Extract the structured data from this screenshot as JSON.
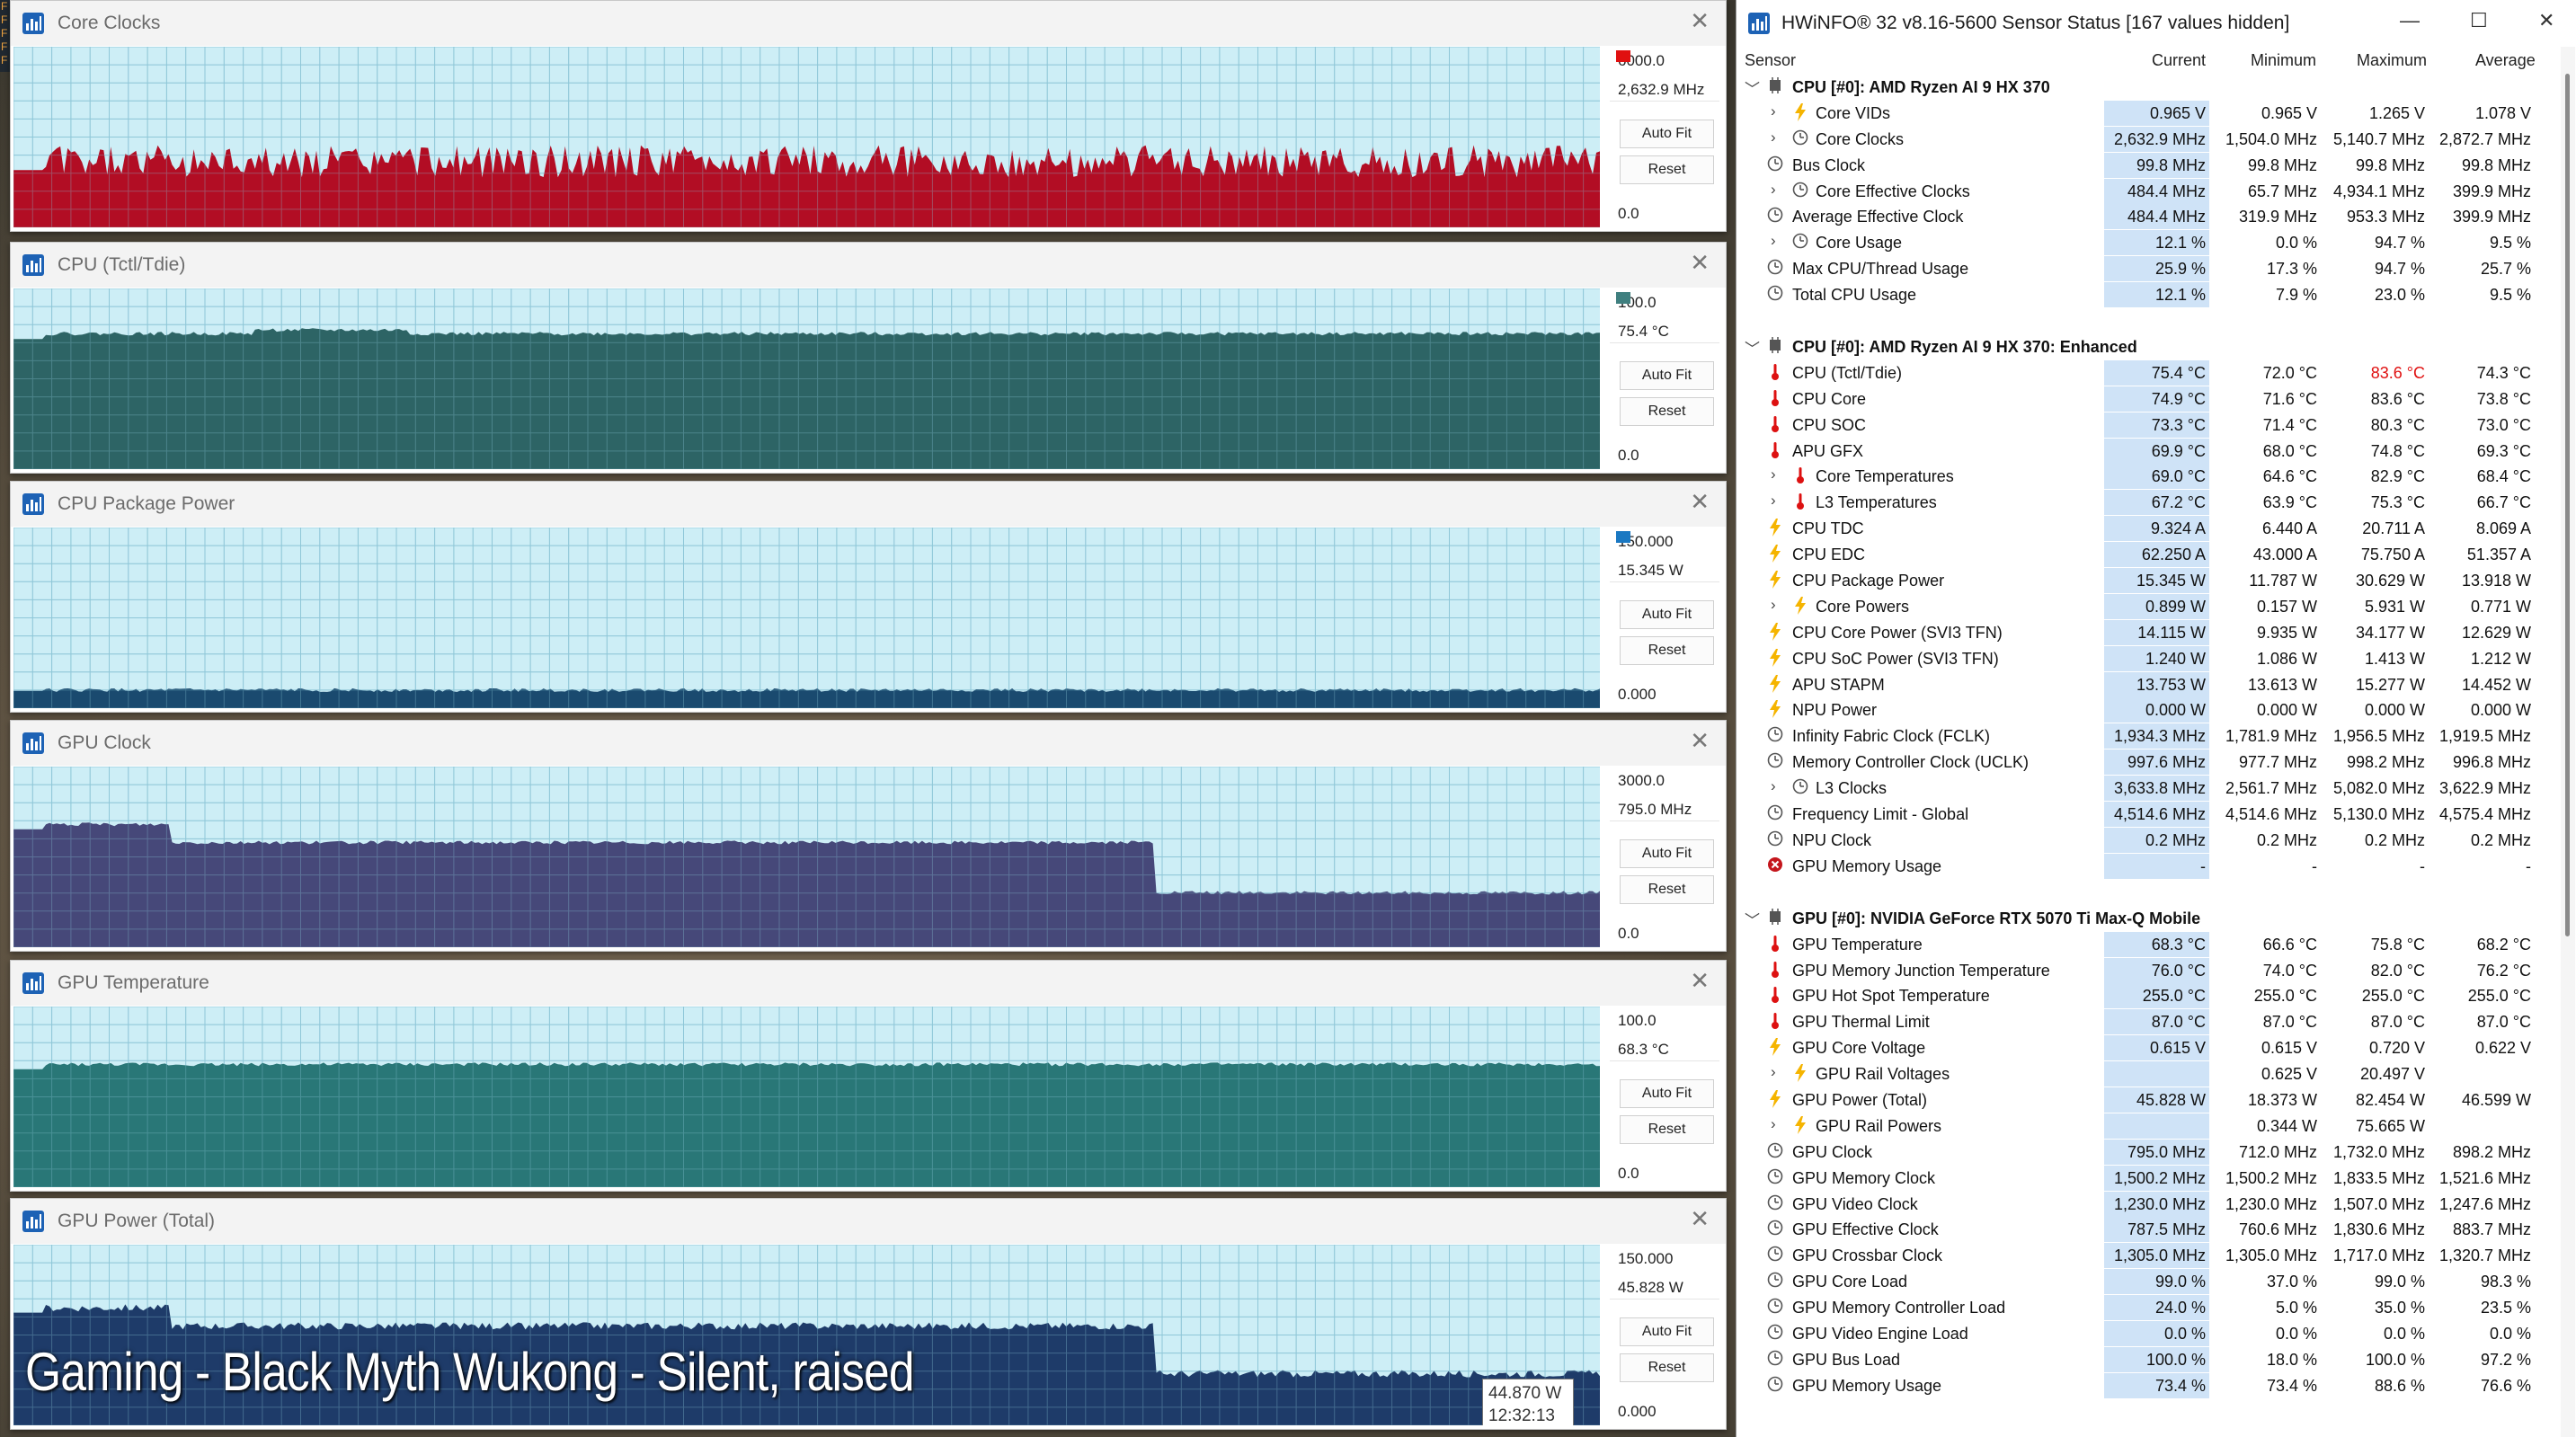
{
  "graphs": [
    {
      "title": "Core Clocks",
      "max": "6000.0",
      "current": "2,632.9 MHz",
      "min": "0.0",
      "color": "#c8001e",
      "fill": "#b00018",
      "level": 0.33,
      "noise": 0.06,
      "kind": "spiky",
      "swatch": "#e01010"
    },
    {
      "title": "CPU (Tctl/Tdie)",
      "max": "100.0",
      "current": "75.4 °C",
      "min": "0.0",
      "color": "#2f6a6a",
      "fill": "#1f5858",
      "level": 0.75,
      "noise": 0.01,
      "kind": "flat",
      "swatch": "#3f7f7f"
    },
    {
      "title": "CPU Package Power",
      "max": "150.000",
      "current": "15.345 W",
      "min": "0.000",
      "color": "#0b3c63",
      "fill": "#0b3c63",
      "level": 0.1,
      "noise": 0.01,
      "kind": "flat",
      "swatch": "#1a78c2"
    },
    {
      "title": "GPU Clock",
      "max": "3000.0",
      "current": "795.0 MHz",
      "min": "0.0",
      "color": "#3b3a6e",
      "fill": "#3b3a6e",
      "level": 0.58,
      "noise": 0.01,
      "kind": "drop",
      "swatch": ""
    },
    {
      "title": "GPU Temperature",
      "max": "100.0",
      "current": "68.3 °C",
      "min": "0.0",
      "color": "#1b6d6b",
      "fill": "#1b6d6b",
      "level": 0.68,
      "noise": 0.01,
      "kind": "flat",
      "swatch": ""
    },
    {
      "title": "GPU Power (Total)",
      "max": "150.000",
      "current": "45.828 W",
      "min": "0.000",
      "color": "#0f2b5c",
      "fill": "#0f2b5c",
      "level": 0.55,
      "noise": 0.02,
      "kind": "drop",
      "swatch": ""
    }
  ],
  "buttons": {
    "autofit": "Auto Fit",
    "reset": "Reset"
  },
  "tooltip": {
    "value": "44.870 W",
    "time": "12:32:13"
  },
  "caption": "Gaming - Black Myth Wukong - Silent, raised",
  "edge_letters": [
    "F",
    "F",
    "F",
    "F",
    "F"
  ],
  "hwinfo": {
    "title": "HWiNFO® 32 v8.16-5600 Sensor Status [167 values hidden]",
    "columns": [
      "Sensor",
      "Current",
      "Minimum",
      "Maximum",
      "Average"
    ],
    "rows": [
      {
        "type": "group",
        "name": "CPU [#0]: AMD Ryzen AI 9 HX 370"
      },
      {
        "name": "Core VIDs",
        "icon": "bolt",
        "indent": 2,
        "exp": true,
        "cur": "0.965 V",
        "min": "0.965 V",
        "max": "1.265 V",
        "avg": "1.078 V"
      },
      {
        "name": "Core Clocks",
        "icon": "clock",
        "indent": 2,
        "exp": true,
        "cur": "2,632.9 MHz",
        "min": "1,504.0 MHz",
        "max": "5,140.7 MHz",
        "avg": "2,872.7 MHz"
      },
      {
        "name": "Bus Clock",
        "icon": "clock",
        "indent": 1,
        "cur": "99.8 MHz",
        "min": "99.8 MHz",
        "max": "99.8 MHz",
        "avg": "99.8 MHz"
      },
      {
        "name": "Core Effective Clocks",
        "icon": "clock",
        "indent": 2,
        "exp": true,
        "cur": "484.4 MHz",
        "min": "65.7 MHz",
        "max": "4,934.1 MHz",
        "avg": "399.9 MHz"
      },
      {
        "name": "Average Effective Clock",
        "icon": "clock",
        "indent": 1,
        "cur": "484.4 MHz",
        "min": "319.9 MHz",
        "max": "953.3 MHz",
        "avg": "399.9 MHz"
      },
      {
        "name": "Core Usage",
        "icon": "clock",
        "indent": 2,
        "exp": true,
        "cur": "12.1 %",
        "min": "0.0 %",
        "max": "94.7 %",
        "avg": "9.5 %"
      },
      {
        "name": "Max CPU/Thread Usage",
        "icon": "clock",
        "indent": 1,
        "cur": "25.9 %",
        "min": "17.3 %",
        "max": "94.7 %",
        "avg": "25.7 %"
      },
      {
        "name": "Total CPU Usage",
        "icon": "clock",
        "indent": 1,
        "cur": "12.1 %",
        "min": "7.9 %",
        "max": "23.0 %",
        "avg": "9.5 %"
      },
      {
        "type": "blank"
      },
      {
        "type": "group",
        "name": "CPU [#0]: AMD Ryzen AI 9 HX 370: Enhanced"
      },
      {
        "name": "CPU (Tctl/Tdie)",
        "icon": "therm",
        "indent": 1,
        "cur": "75.4 °C",
        "min": "72.0 °C",
        "max": "83.6 °C",
        "avg": "74.3 °C",
        "hotmax": true
      },
      {
        "name": "CPU Core",
        "icon": "therm",
        "indent": 1,
        "cur": "74.9 °C",
        "min": "71.6 °C",
        "max": "83.6 °C",
        "avg": "73.8 °C"
      },
      {
        "name": "CPU SOC",
        "icon": "therm",
        "indent": 1,
        "cur": "73.3 °C",
        "min": "71.4 °C",
        "max": "80.3 °C",
        "avg": "73.0 °C"
      },
      {
        "name": "APU GFX",
        "icon": "therm",
        "indent": 1,
        "cur": "69.9 °C",
        "min": "68.0 °C",
        "max": "74.8 °C",
        "avg": "69.3 °C"
      },
      {
        "name": "Core Temperatures",
        "icon": "therm",
        "indent": 2,
        "exp": true,
        "cur": "69.0 °C",
        "min": "64.6 °C",
        "max": "82.9 °C",
        "avg": "68.4 °C"
      },
      {
        "name": "L3 Temperatures",
        "icon": "therm",
        "indent": 2,
        "exp": true,
        "cur": "67.2 °C",
        "min": "63.9 °C",
        "max": "75.3 °C",
        "avg": "66.7 °C"
      },
      {
        "name": "CPU TDC",
        "icon": "bolt",
        "indent": 1,
        "cur": "9.324 A",
        "min": "6.440 A",
        "max": "20.711 A",
        "avg": "8.069 A"
      },
      {
        "name": "CPU EDC",
        "icon": "bolt",
        "indent": 1,
        "cur": "62.250 A",
        "min": "43.000 A",
        "max": "75.750 A",
        "avg": "51.357 A"
      },
      {
        "name": "CPU Package Power",
        "icon": "bolt",
        "indent": 1,
        "cur": "15.345 W",
        "min": "11.787 W",
        "max": "30.629 W",
        "avg": "13.918 W"
      },
      {
        "name": "Core Powers",
        "icon": "bolt",
        "indent": 2,
        "exp": true,
        "cur": "0.899 W",
        "min": "0.157 W",
        "max": "5.931 W",
        "avg": "0.771 W"
      },
      {
        "name": "CPU Core Power (SVI3 TFN)",
        "icon": "bolt",
        "indent": 1,
        "cur": "14.115 W",
        "min": "9.935 W",
        "max": "34.177 W",
        "avg": "12.629 W"
      },
      {
        "name": "CPU SoC Power (SVI3 TFN)",
        "icon": "bolt",
        "indent": 1,
        "cur": "1.240 W",
        "min": "1.086 W",
        "max": "1.413 W",
        "avg": "1.212 W"
      },
      {
        "name": "APU STAPM",
        "icon": "bolt",
        "indent": 1,
        "cur": "13.753 W",
        "min": "13.613 W",
        "max": "15.277 W",
        "avg": "14.452 W"
      },
      {
        "name": "NPU Power",
        "icon": "bolt",
        "indent": 1,
        "cur": "0.000 W",
        "min": "0.000 W",
        "max": "0.000 W",
        "avg": "0.000 W"
      },
      {
        "name": "Infinity Fabric Clock (FCLK)",
        "icon": "clock",
        "indent": 1,
        "cur": "1,934.3 MHz",
        "min": "1,781.9 MHz",
        "max": "1,956.5 MHz",
        "avg": "1,919.5 MHz"
      },
      {
        "name": "Memory Controller Clock (UCLK)",
        "icon": "clock",
        "indent": 1,
        "cur": "997.6 MHz",
        "min": "977.7 MHz",
        "max": "998.2 MHz",
        "avg": "996.8 MHz"
      },
      {
        "name": "L3 Clocks",
        "icon": "clock",
        "indent": 2,
        "exp": true,
        "cur": "3,633.8 MHz",
        "min": "2,561.7 MHz",
        "max": "5,082.0 MHz",
        "avg": "3,622.9 MHz"
      },
      {
        "name": "Frequency Limit - Global",
        "icon": "clock",
        "indent": 1,
        "cur": "4,514.6 MHz",
        "min": "4,514.6 MHz",
        "max": "5,130.0 MHz",
        "avg": "4,575.4 MHz"
      },
      {
        "name": "NPU Clock",
        "icon": "clock",
        "indent": 1,
        "cur": "0.2 MHz",
        "min": "0.2 MHz",
        "max": "0.2 MHz",
        "avg": "0.2 MHz"
      },
      {
        "name": "GPU Memory Usage",
        "icon": "error",
        "indent": 1,
        "cur": "-",
        "min": "-",
        "max": "-",
        "avg": "-"
      },
      {
        "type": "blank"
      },
      {
        "type": "group",
        "name": "GPU [#0]: NVIDIA  GeForce RTX 5070 Ti Max-Q Mobile"
      },
      {
        "name": "GPU Temperature",
        "icon": "therm",
        "indent": 1,
        "cur": "68.3 °C",
        "min": "66.6 °C",
        "max": "75.8 °C",
        "avg": "68.2 °C"
      },
      {
        "name": "GPU Memory Junction Temperature",
        "icon": "therm",
        "indent": 1,
        "cur": "76.0 °C",
        "min": "74.0 °C",
        "max": "82.0 °C",
        "avg": "76.2 °C"
      },
      {
        "name": "GPU Hot Spot Temperature",
        "icon": "therm",
        "indent": 1,
        "cur": "255.0 °C",
        "min": "255.0 °C",
        "max": "255.0 °C",
        "avg": "255.0 °C"
      },
      {
        "name": "GPU Thermal Limit",
        "icon": "therm",
        "indent": 1,
        "cur": "87.0 °C",
        "min": "87.0 °C",
        "max": "87.0 °C",
        "avg": "87.0 °C"
      },
      {
        "name": "GPU Core Voltage",
        "icon": "bolt",
        "indent": 1,
        "cur": "0.615 V",
        "min": "0.615 V",
        "max": "0.720 V",
        "avg": "0.622 V"
      },
      {
        "name": "GPU Rail Voltages",
        "icon": "bolt",
        "indent": 2,
        "exp": true,
        "cur": "",
        "min": "0.625 V",
        "max": "20.497 V",
        "avg": ""
      },
      {
        "name": "GPU Power (Total)",
        "icon": "bolt",
        "indent": 1,
        "cur": "45.828 W",
        "min": "18.373 W",
        "max": "82.454 W",
        "avg": "46.599 W"
      },
      {
        "name": "GPU Rail Powers",
        "icon": "bolt",
        "indent": 2,
        "exp": true,
        "cur": "",
        "min": "0.344 W",
        "max": "75.665 W",
        "avg": ""
      },
      {
        "name": "GPU Clock",
        "icon": "clock",
        "indent": 1,
        "cur": "795.0 MHz",
        "min": "712.0 MHz",
        "max": "1,732.0 MHz",
        "avg": "898.2 MHz"
      },
      {
        "name": "GPU Memory Clock",
        "icon": "clock",
        "indent": 1,
        "cur": "1,500.2 MHz",
        "min": "1,500.2 MHz",
        "max": "1,833.5 MHz",
        "avg": "1,521.6 MHz"
      },
      {
        "name": "GPU Video Clock",
        "icon": "clock",
        "indent": 1,
        "cur": "1,230.0 MHz",
        "min": "1,230.0 MHz",
        "max": "1,507.0 MHz",
        "avg": "1,247.6 MHz"
      },
      {
        "name": "GPU Effective Clock",
        "icon": "clock",
        "indent": 1,
        "cur": "787.5 MHz",
        "min": "760.6 MHz",
        "max": "1,830.6 MHz",
        "avg": "883.7 MHz"
      },
      {
        "name": "GPU Crossbar Clock",
        "icon": "clock",
        "indent": 1,
        "cur": "1,305.0 MHz",
        "min": "1,305.0 MHz",
        "max": "1,717.0 MHz",
        "avg": "1,320.7 MHz"
      },
      {
        "name": "GPU Core Load",
        "icon": "clock",
        "indent": 1,
        "cur": "99.0 %",
        "min": "37.0 %",
        "max": "99.0 %",
        "avg": "98.3 %"
      },
      {
        "name": "GPU Memory Controller Load",
        "icon": "clock",
        "indent": 1,
        "cur": "24.0 %",
        "min": "5.0 %",
        "max": "35.0 %",
        "avg": "23.5 %"
      },
      {
        "name": "GPU Video Engine Load",
        "icon": "clock",
        "indent": 1,
        "cur": "0.0 %",
        "min": "0.0 %",
        "max": "0.0 %",
        "avg": "0.0 %"
      },
      {
        "name": "GPU Bus Load",
        "icon": "clock",
        "indent": 1,
        "cur": "100.0 %",
        "min": "18.0 %",
        "max": "100.0 %",
        "avg": "97.2 %"
      },
      {
        "name": "GPU Memory Usage",
        "icon": "clock",
        "indent": 1,
        "cur": "73.4 %",
        "min": "73.4 %",
        "max": "88.6 %",
        "avg": "76.6 %"
      }
    ]
  }
}
